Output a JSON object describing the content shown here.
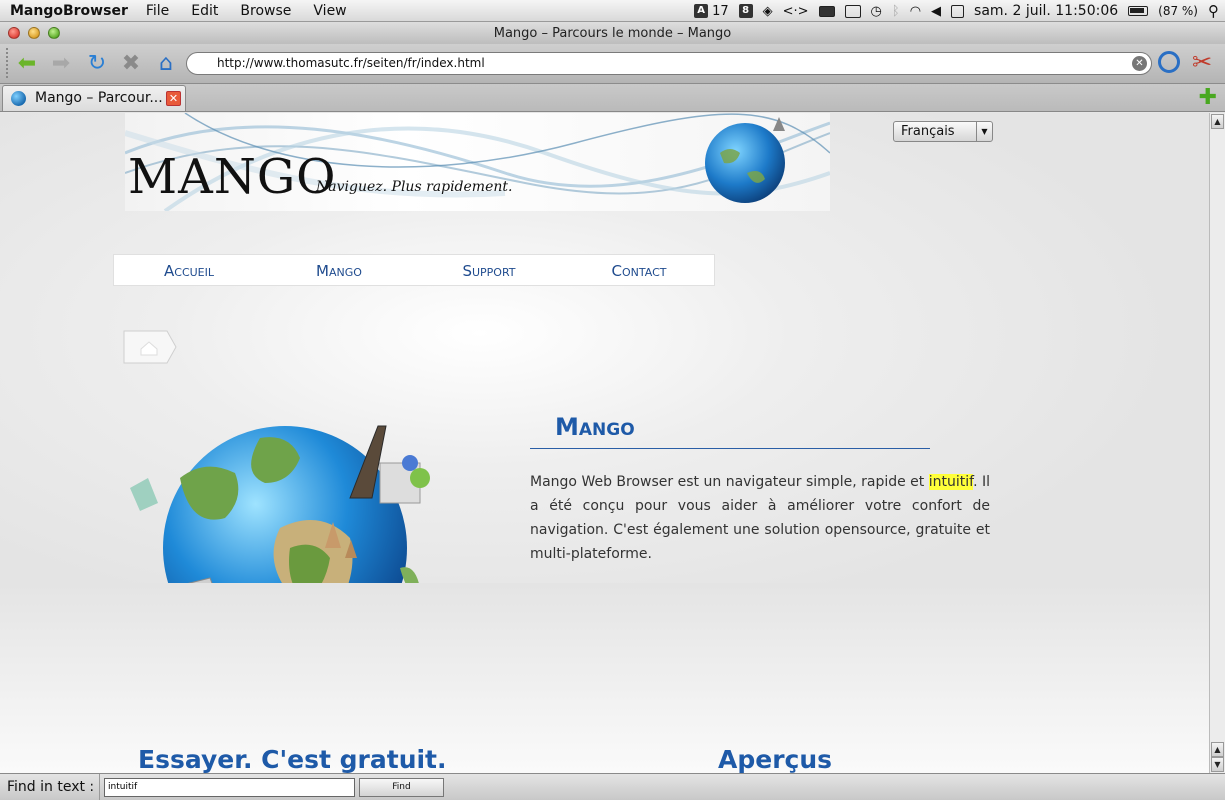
{
  "menubar": {
    "app_name": "MangoBrowser",
    "menus": [
      "File",
      "Edit",
      "Browse",
      "View"
    ],
    "status": {
      "calendar_day": "17",
      "datetime": "sam. 2 juil.  11:50:06",
      "battery": "(87 %)"
    }
  },
  "window": {
    "title": "Mango – Parcours le monde – Mango"
  },
  "toolbar": {
    "url": "http://www.thomasutc.fr/seiten/fr/index.html"
  },
  "tabs": [
    {
      "label": "Mango – Parcour...",
      "active": true
    }
  ],
  "page": {
    "logo": "MANGO",
    "tagline": "Naviguez. Plus rapidement.",
    "language_select": "Français",
    "nav": [
      "Accueil",
      "Mango",
      "Support",
      "Contact"
    ],
    "article": {
      "title": "Mango",
      "text_before": "Mango Web Browser est un navigateur simple, rapide et ",
      "highlight": "intuitif",
      "text_after": ". Il a été conçu pour vous aider à améliorer votre confort de navigation. C'est également une solution opensource, gratuite et multi-plateforme."
    },
    "section_try": "Essayer. C'est gratuit.",
    "section_preview": "Aperçus"
  },
  "findbar": {
    "label": "Find in text :",
    "value": "intuitif",
    "button": "Find"
  },
  "colors": {
    "link_blue": "#1f4b8e",
    "heading_blue": "#1e5aa8",
    "highlight": "#ffff3a"
  }
}
